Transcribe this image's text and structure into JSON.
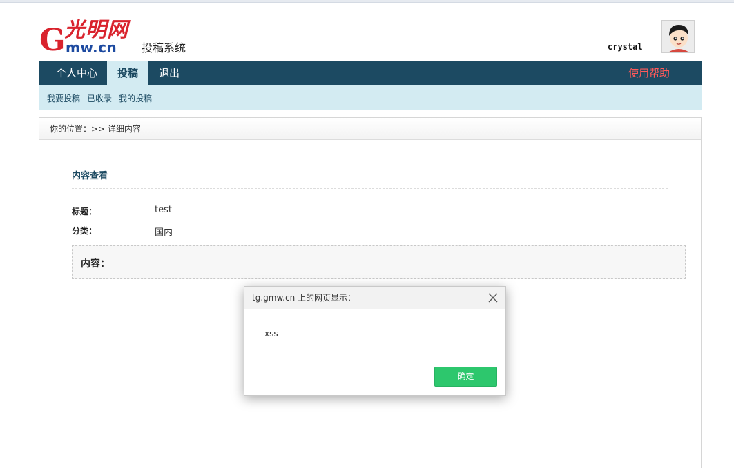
{
  "header": {
    "logo_cn": "光明网",
    "logo_g": "G",
    "logo_domain": "mw.cn",
    "system_name": "投稿系统",
    "username": "crystal"
  },
  "nav": {
    "items": [
      {
        "label": "个人中心"
      },
      {
        "label": "投稿"
      },
      {
        "label": "退出"
      }
    ],
    "active": "投稿",
    "help": "使用帮助"
  },
  "subnav": {
    "items": [
      {
        "label": "我要投稿"
      },
      {
        "label": "已收录"
      },
      {
        "label": "我的投稿"
      }
    ]
  },
  "breadcrumb": "你的位置：>> 详细内容",
  "detail": {
    "section_title": "内容查看",
    "title_label": "标题：",
    "title_value": "test",
    "category_label": "分类：",
    "category_value": "国内",
    "content_label": "内容："
  },
  "dialog": {
    "title": "tg.gmw.cn 上的网页显示：",
    "message": "xss",
    "ok_label": "确定"
  },
  "colors": {
    "nav_bg": "#1c4a62",
    "subnav_bg": "#d3ebf2",
    "help_text": "#ff5a5a",
    "ok_button": "#2dc76d",
    "logo_red": "#d9232d",
    "logo_blue": "#1d4aa0"
  }
}
